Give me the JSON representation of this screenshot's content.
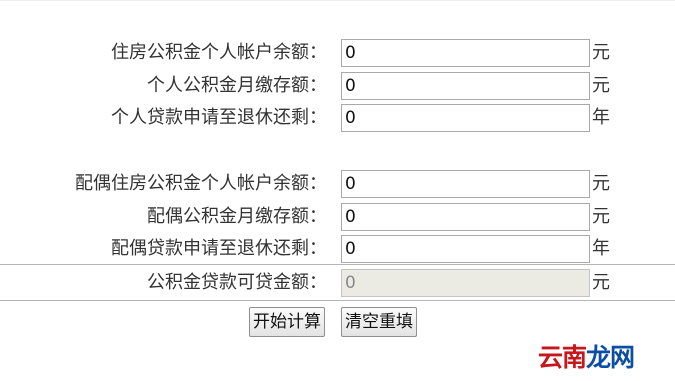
{
  "fields": [
    {
      "label": "住房公积金个人帐户余额：",
      "value": "0",
      "unit": "元"
    },
    {
      "label": "个人公积金月缴存额：",
      "value": "0",
      "unit": "元"
    },
    {
      "label": "个人贷款申请至退休还剩：",
      "value": "0",
      "unit": "年"
    },
    {
      "label": "配偶住房公积金个人帐户余额：",
      "value": "0",
      "unit": "元"
    },
    {
      "label": "配偶公积金月缴存额：",
      "value": "0",
      "unit": "元"
    },
    {
      "label": "配偶贷款申请至退休还剩：",
      "value": "0",
      "unit": "年"
    }
  ],
  "result": {
    "label": "公积金贷款可贷金额：",
    "value": "0",
    "unit": "元"
  },
  "buttons": {
    "calculate": "开始计算",
    "reset": "清空重填"
  },
  "watermark": {
    "main": "云南",
    "tail": "龙网"
  }
}
